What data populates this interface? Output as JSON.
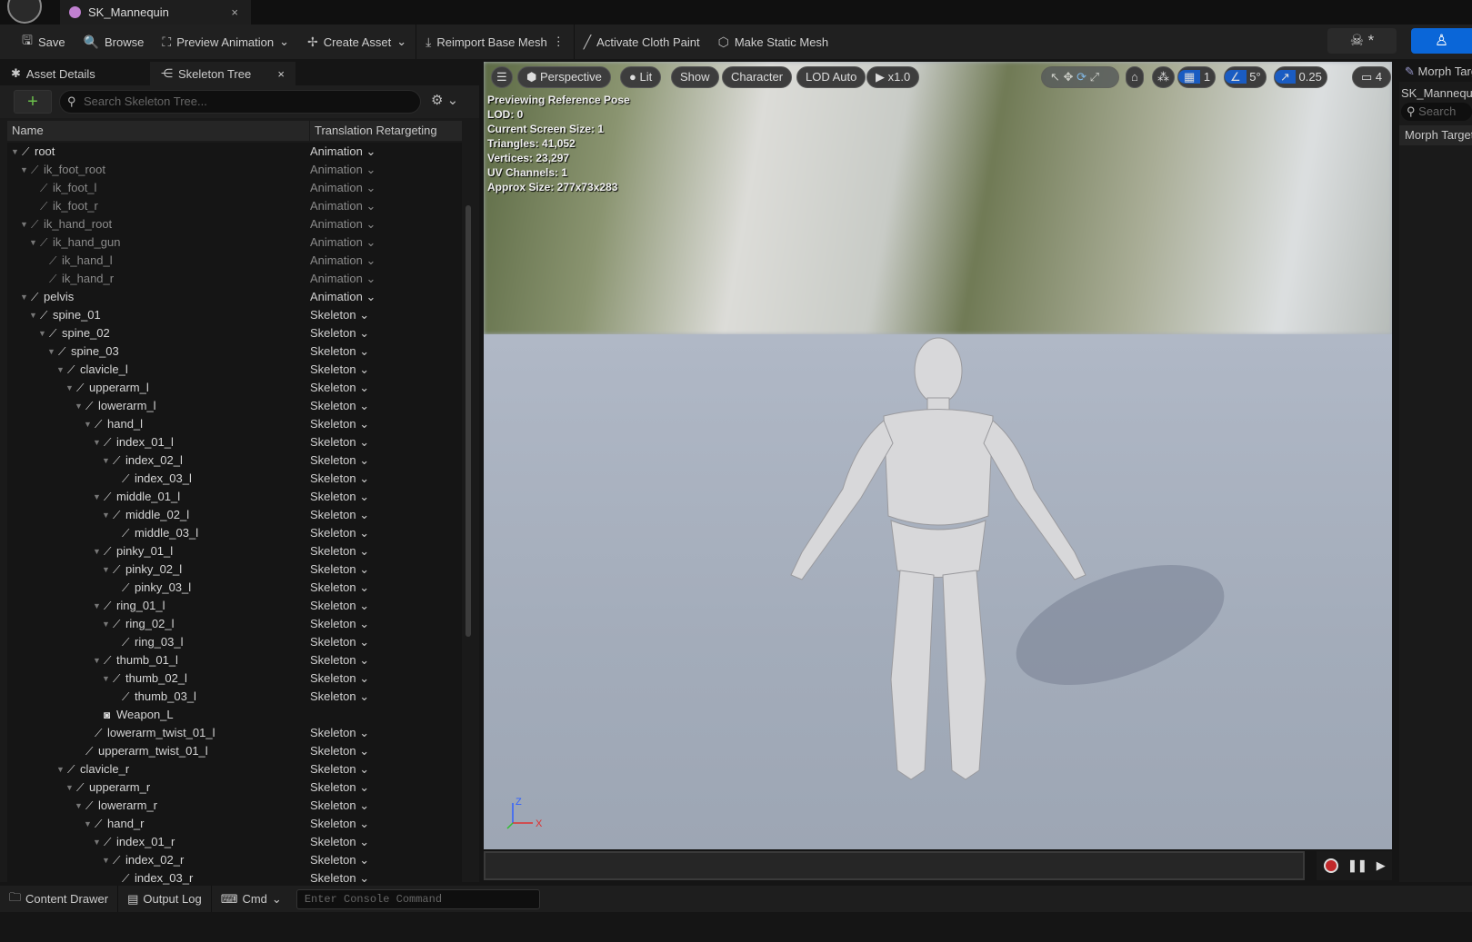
{
  "window": {
    "tab_title": "SK_Mannequin",
    "close": "×"
  },
  "toolbar": {
    "save": "Save",
    "browse": "Browse",
    "preview_animation": "Preview Animation",
    "create_asset": "Create Asset",
    "reimport": "Reimport Base Mesh",
    "cloth": "Activate Cloth Paint",
    "static_mesh": "Make Static Mesh",
    "more": "⋮"
  },
  "left_panel": {
    "tabs": [
      {
        "label": "Asset Details"
      },
      {
        "label": "Skeleton Tree"
      }
    ],
    "search_placeholder": "Search Skeleton Tree...",
    "columns": [
      "Name",
      "Translation Retargeting"
    ],
    "rows": [
      {
        "name": "root",
        "depth": 0,
        "retarget": "Animation",
        "dim": false
      },
      {
        "name": "ik_foot_root",
        "depth": 1,
        "retarget": "Animation",
        "dim": true
      },
      {
        "name": "ik_foot_l",
        "depth": 2,
        "retarget": "Animation",
        "dim": true,
        "leaf": true
      },
      {
        "name": "ik_foot_r",
        "depth": 2,
        "retarget": "Animation",
        "dim": true,
        "leaf": true
      },
      {
        "name": "ik_hand_root",
        "depth": 1,
        "retarget": "Animation",
        "dim": true
      },
      {
        "name": "ik_hand_gun",
        "depth": 2,
        "retarget": "Animation",
        "dim": true
      },
      {
        "name": "ik_hand_l",
        "depth": 3,
        "retarget": "Animation",
        "dim": true,
        "leaf": true
      },
      {
        "name": "ik_hand_r",
        "depth": 3,
        "retarget": "Animation",
        "dim": true,
        "leaf": true
      },
      {
        "name": "pelvis",
        "depth": 1,
        "retarget": "Animation"
      },
      {
        "name": "spine_01",
        "depth": 2,
        "retarget": "Skeleton"
      },
      {
        "name": "spine_02",
        "depth": 3,
        "retarget": "Skeleton"
      },
      {
        "name": "spine_03",
        "depth": 4,
        "retarget": "Skeleton"
      },
      {
        "name": "clavicle_l",
        "depth": 5,
        "retarget": "Skeleton"
      },
      {
        "name": "upperarm_l",
        "depth": 6,
        "retarget": "Skeleton"
      },
      {
        "name": "lowerarm_l",
        "depth": 7,
        "retarget": "Skeleton"
      },
      {
        "name": "hand_l",
        "depth": 8,
        "retarget": "Skeleton"
      },
      {
        "name": "index_01_l",
        "depth": 9,
        "retarget": "Skeleton"
      },
      {
        "name": "index_02_l",
        "depth": 10,
        "retarget": "Skeleton"
      },
      {
        "name": "index_03_l",
        "depth": 11,
        "retarget": "Skeleton",
        "leaf": true
      },
      {
        "name": "middle_01_l",
        "depth": 9,
        "retarget": "Skeleton"
      },
      {
        "name": "middle_02_l",
        "depth": 10,
        "retarget": "Skeleton"
      },
      {
        "name": "middle_03_l",
        "depth": 11,
        "retarget": "Skeleton",
        "leaf": true
      },
      {
        "name": "pinky_01_l",
        "depth": 9,
        "retarget": "Skeleton"
      },
      {
        "name": "pinky_02_l",
        "depth": 10,
        "retarget": "Skeleton"
      },
      {
        "name": "pinky_03_l",
        "depth": 11,
        "retarget": "Skeleton",
        "leaf": true
      },
      {
        "name": "ring_01_l",
        "depth": 9,
        "retarget": "Skeleton"
      },
      {
        "name": "ring_02_l",
        "depth": 10,
        "retarget": "Skeleton"
      },
      {
        "name": "ring_03_l",
        "depth": 11,
        "retarget": "Skeleton",
        "leaf": true
      },
      {
        "name": "thumb_01_l",
        "depth": 9,
        "retarget": "Skeleton"
      },
      {
        "name": "thumb_02_l",
        "depth": 10,
        "retarget": "Skeleton"
      },
      {
        "name": "thumb_03_l",
        "depth": 11,
        "retarget": "Skeleton",
        "leaf": true
      },
      {
        "name": "Weapon_L",
        "depth": 9,
        "retarget": "",
        "socket": true,
        "leaf": true
      },
      {
        "name": "lowerarm_twist_01_l",
        "depth": 8,
        "retarget": "Skeleton",
        "leaf": true
      },
      {
        "name": "upperarm_twist_01_l",
        "depth": 7,
        "retarget": "Skeleton",
        "leaf": true
      },
      {
        "name": "clavicle_r",
        "depth": 5,
        "retarget": "Skeleton"
      },
      {
        "name": "upperarm_r",
        "depth": 6,
        "retarget": "Skeleton"
      },
      {
        "name": "lowerarm_r",
        "depth": 7,
        "retarget": "Skeleton"
      },
      {
        "name": "hand_r",
        "depth": 8,
        "retarget": "Skeleton"
      },
      {
        "name": "index_01_r",
        "depth": 9,
        "retarget": "Skeleton"
      },
      {
        "name": "index_02_r",
        "depth": 10,
        "retarget": "Skeleton"
      },
      {
        "name": "index_03_r",
        "depth": 11,
        "retarget": "Skeleton",
        "leaf": true
      }
    ]
  },
  "viewport": {
    "buttons": {
      "perspective": "Perspective",
      "lit": "Lit",
      "show": "Show",
      "character": "Character",
      "lod": "LOD Auto",
      "speed": "x1.0",
      "grid": "1",
      "angle": "5°",
      "scale": "0.25",
      "camera": "4"
    },
    "stats": [
      "Previewing Reference Pose",
      "LOD: 0",
      "Current Screen Size: 1",
      "Triangles: 41,052",
      "Vertices: 23,297",
      "UV Channels: 1",
      "Approx Size: 277x73x283"
    ],
    "axis": {
      "z": "Z",
      "x": "X"
    }
  },
  "right_panel": {
    "tab": "Morph Targets",
    "asset": "SK_Mannequin",
    "search_placeholder": "Search",
    "column": "Morph Target"
  },
  "statusbar": {
    "content_drawer": "Content Drawer",
    "output_log": "Output Log",
    "cmd": "Cmd",
    "console_placeholder": "Enter Console Command"
  },
  "colors": {
    "accent": "#0a66d8",
    "add": "#6bc04b",
    "record": "#c0282a"
  }
}
